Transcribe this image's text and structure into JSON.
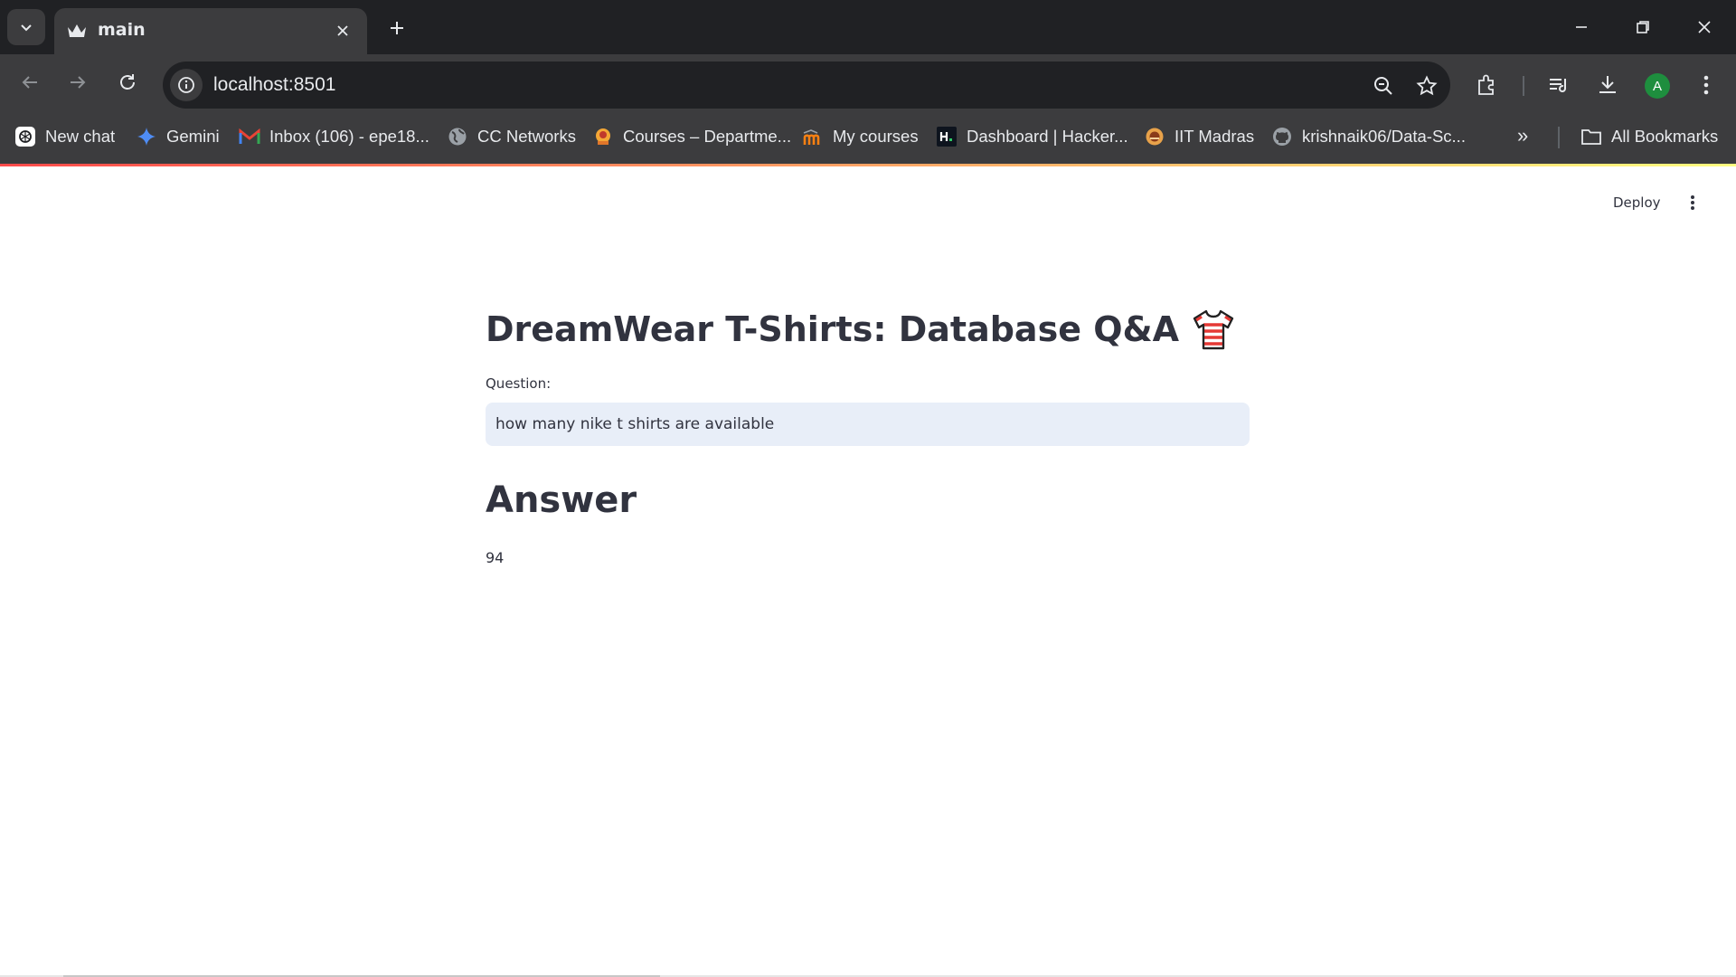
{
  "browser": {
    "tab_title": "main",
    "url": "localhost:8501",
    "avatar_letter": "A"
  },
  "bookmarks": [
    {
      "label": "New chat",
      "icon": "openai-icon"
    },
    {
      "label": "Gemini",
      "icon": "gemini-icon"
    },
    {
      "label": "Inbox (106) - epe18...",
      "icon": "gmail-icon"
    },
    {
      "label": "CC Networks",
      "icon": "globe-icon"
    },
    {
      "label": "Courses – Departme...",
      "icon": "courses-icon"
    },
    {
      "label": "My courses",
      "icon": "moodle-icon"
    },
    {
      "label": "Dashboard | Hacker...",
      "icon": "hackerrank-icon"
    },
    {
      "label": "IIT Madras",
      "icon": "iitm-icon"
    },
    {
      "label": "krishnaik06/Data-Sc...",
      "icon": "github-icon"
    }
  ],
  "bookmarks_more": "»",
  "all_bookmarks": "All Bookmarks",
  "app": {
    "deploy_label": "Deploy",
    "title": "DreamWear T-Shirts: Database Q&A",
    "title_emoji": "t-shirt-icon",
    "question_label": "Question:",
    "question_value": "how many nike t shirts are available",
    "answer_heading": "Answer",
    "answer_value": "94"
  },
  "colors": {
    "accent_line_start": "#ff4b4b",
    "accent_line_end": "#fffd80",
    "input_bg": "#e8eef8",
    "text": "#31333f"
  }
}
